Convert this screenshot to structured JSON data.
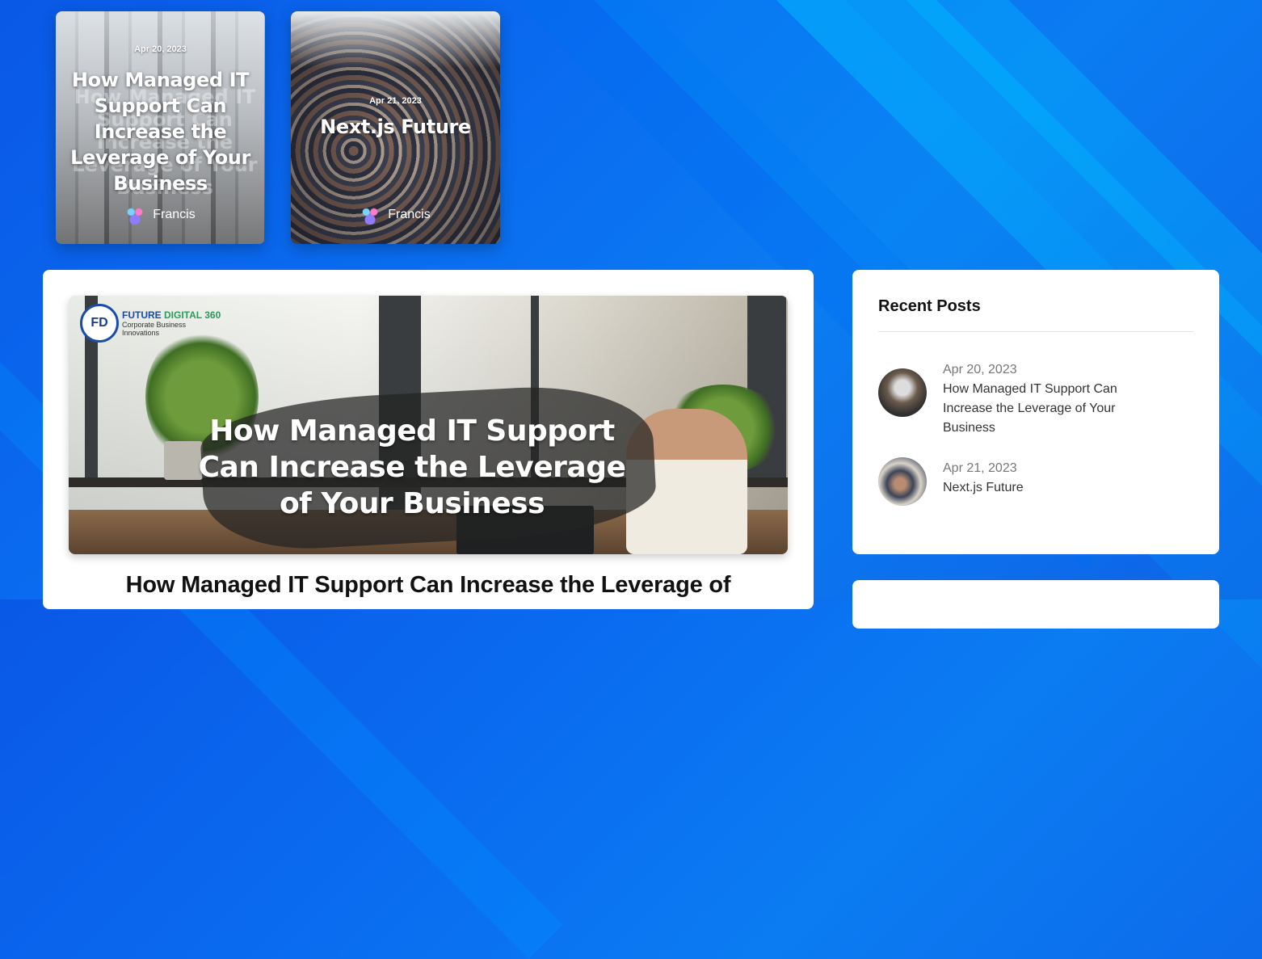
{
  "featured": [
    {
      "date": "Apr 20, 2023",
      "title": "How Managed IT Support Can Increase the Leverage of Your Business",
      "author": "Francis"
    },
    {
      "date": "Apr 21, 2023",
      "title": "Next.js Future",
      "author": "Francis"
    }
  ],
  "main": {
    "hero_overlay_title": "How Managed IT Support Can Increase the Leverage of Your Business",
    "logo": {
      "abbr": "FD",
      "name_part1": "FUTURE ",
      "name_part2": "DIGITAL 360",
      "tagline": "Corporate Business Innovations"
    },
    "title": "How Managed IT Support Can Increase the Leverage of"
  },
  "sidebar": {
    "heading": "Recent Posts",
    "posts": [
      {
        "date": "Apr 20, 2023",
        "title": "How Managed IT Support Can Increase the Leverage of Your Business"
      },
      {
        "date": "Apr 21, 2023",
        "title": "Next.js Future"
      }
    ]
  },
  "colors": {
    "background": "#0a6cf0",
    "accent": "#00c8ff",
    "card": "#ffffff"
  }
}
